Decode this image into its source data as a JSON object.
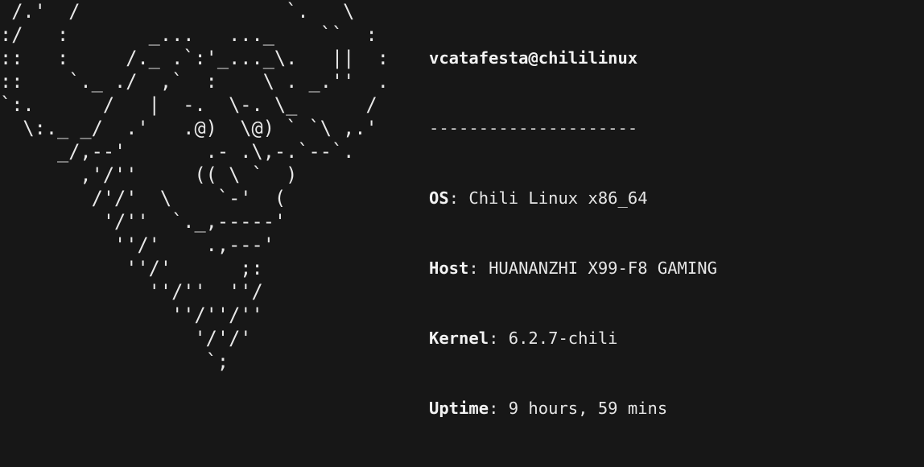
{
  "ascii_logo": [
    " /.'  /                  `.   \\",
    ":/   :       _...   ..._    ``  :",
    "::   :     /._ .`:'_..._\\.   ||  :",
    "::    `._ ./  ,`  :    \\ . _.''  .",
    "`:.      /   |  -.  \\-. \\_      /",
    "  \\:._ _/  .'   .@)  \\@) ` `\\ ,.'",
    "     _/,--'       .- .\\,-.`--`.",
    "       ,'/''     (( \\ `  )",
    "        /'/'  \\    `-'  (",
    "         '/''  `._,-----'",
    "          ''/'    .,---'",
    "           ''/'      ;:",
    "             ''/''  ''/",
    "               ''/''/''",
    "                 '/'/'",
    "                  `;"
  ],
  "info": {
    "user": "vcatafesta",
    "at": "@",
    "host": "chililinux",
    "separator": "---------------------",
    "os_key": "OS",
    "os_value": "Chili Linux x86_64",
    "host_key": "Host",
    "host_value": "HUANANZHI X99-F8 GAMING",
    "kernel_key": "Kernel",
    "kernel_value": "6.2.7-chili",
    "uptime_key": "Uptime",
    "uptime_value": "9 hours, 59 mins",
    "colon": ": "
  }
}
